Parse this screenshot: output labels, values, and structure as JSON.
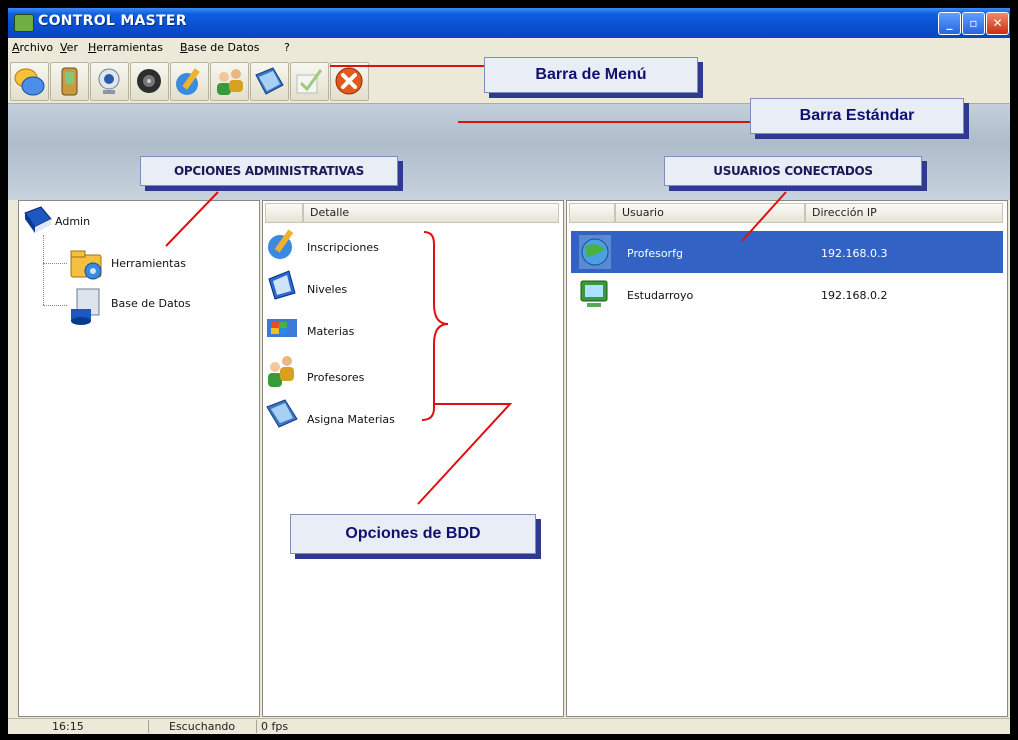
{
  "window": {
    "title": "CONTROL MASTER"
  },
  "menu": {
    "items": [
      "Archivo",
      "Ver",
      "Herramientas",
      "Base de Datos",
      "?"
    ]
  },
  "toolbar": {
    "icons": [
      "chat-bubbles-icon",
      "device-icon",
      "webcam-icon",
      "speaker-icon",
      "edit-icon",
      "users-icon",
      "book-icon",
      "checkmark-icon",
      "exit-icon"
    ]
  },
  "callouts": {
    "menu_bar": "Barra de Menú",
    "standard_bar": "Barra Estándar",
    "admin_options": "OPCIONES ADMINISTRATIVAS",
    "connected_users": "USUARIOS CONECTADOS",
    "db_options": "Opciones de BDD"
  },
  "tree": {
    "root": "Admin",
    "children": [
      "Herramientas",
      "Base de Datos"
    ]
  },
  "detail": {
    "header": "Detalle",
    "items": [
      "Inscripciones",
      "Niveles",
      "Materias",
      "Profesores",
      "Asigna Materias"
    ]
  },
  "users": {
    "columns": [
      "Usuario",
      "Dirección IP"
    ],
    "rows": [
      {
        "user": "Profesorfg",
        "ip": "192.168.0.3",
        "selected": true
      },
      {
        "user": "Estudarroyo",
        "ip": "192.168.0.2",
        "selected": false
      }
    ]
  },
  "status": {
    "time": "16:15",
    "state": "Escuchando",
    "fps": "0 fps"
  },
  "colors": {
    "titlebar": "#0a4fd0",
    "selection": "#3162c4",
    "callout_shadow": "#2f3a8f",
    "annotation_line": "#e01010"
  }
}
